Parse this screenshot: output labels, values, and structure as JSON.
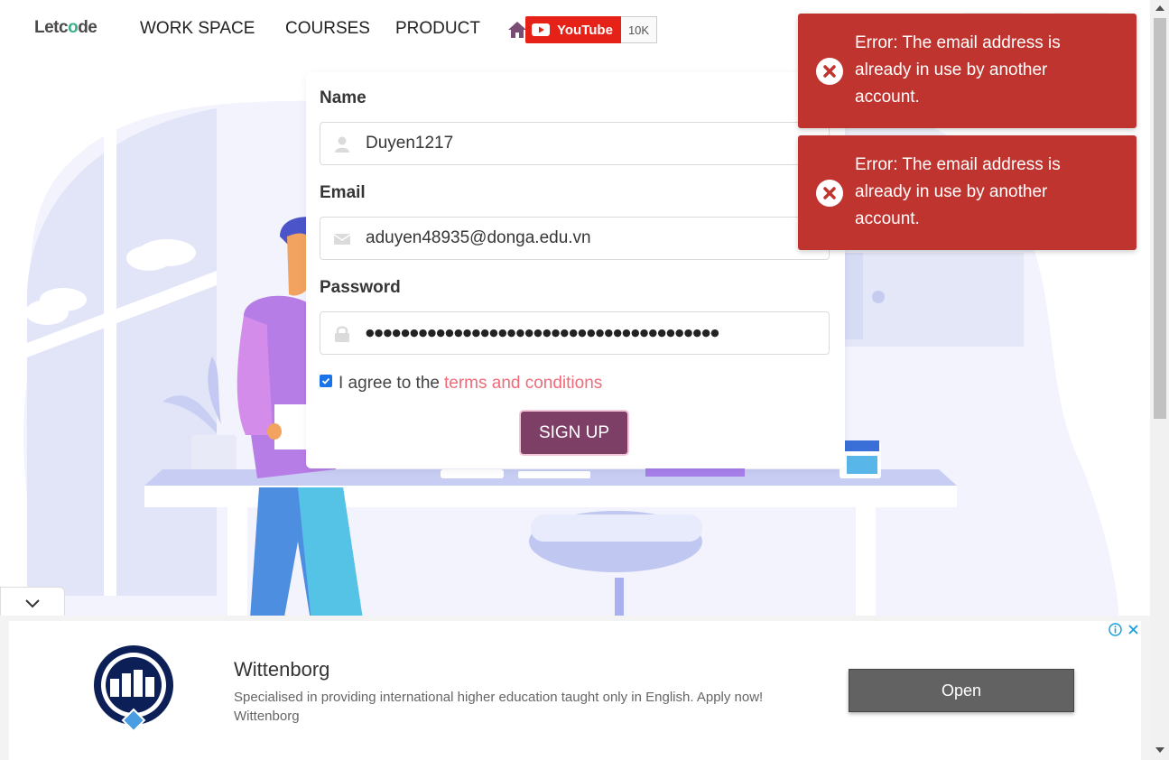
{
  "nav": {
    "logo_left": "Letc",
    "logo_oo": "o",
    "logo_right": "de",
    "links": [
      "WORK SPACE",
      "COURSES",
      "PRODUCT"
    ],
    "youtube_label": "YouTube",
    "youtube_count": "10K"
  },
  "form": {
    "name_label": "Name",
    "name_value": "Duyen1217",
    "email_label": "Email",
    "email_value": "aduyen48935@donga.edu.vn",
    "password_label": "Password",
    "password_mask": "●●●●●●●●●●●●●●●●●●●●●●●●●●●●●●●●●●●●●●●●",
    "agree_text": "I agree to the",
    "agree_checked": true,
    "terms_link": "terms and conditions",
    "signup_label": "SIGN UP"
  },
  "toasts": [
    {
      "message": "Error: The email address is already in use by another account."
    },
    {
      "message": "Error: The email address is already in use by another account."
    }
  ],
  "ad": {
    "title": "Wittenborg",
    "description": "Specialised in providing international higher education taught only in English. Apply now! Wittenborg",
    "open_label": "Open"
  },
  "colors": {
    "toast_bg": "#c0342f",
    "signup_bg": "#7d3f66",
    "terms_link": "#f06b7a",
    "youtube_red": "#e62117"
  }
}
